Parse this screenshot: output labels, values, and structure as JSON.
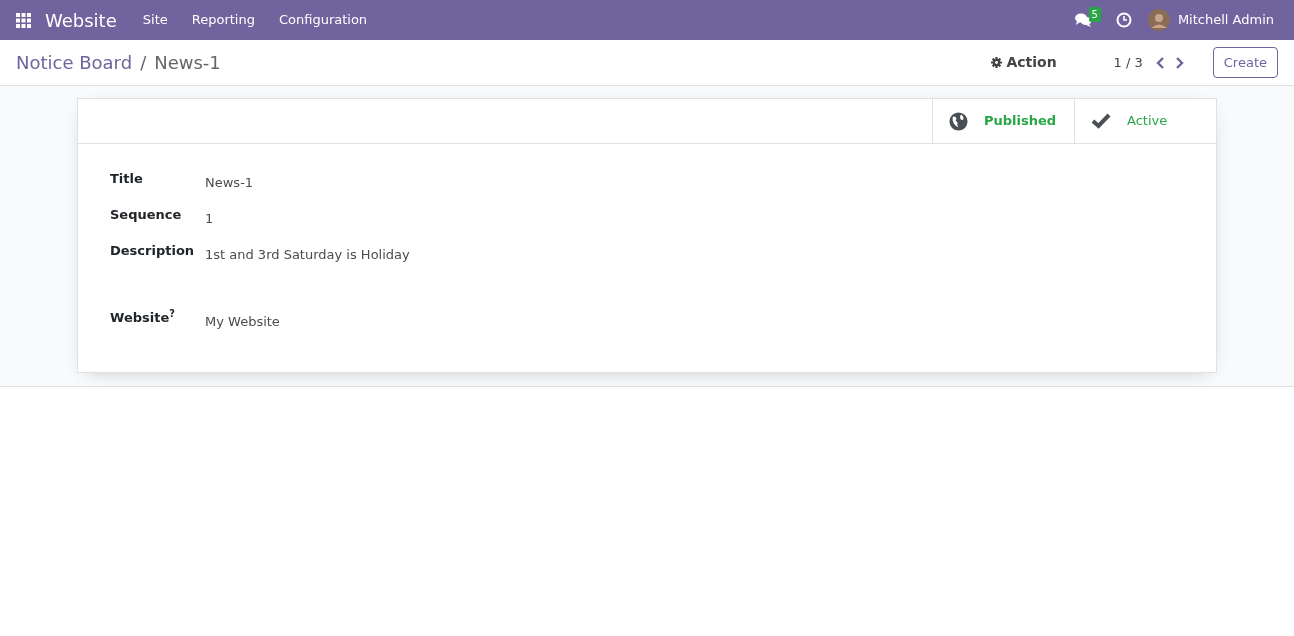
{
  "navbar": {
    "app": "Website",
    "menus": [
      "Site",
      "Reporting",
      "Configuration"
    ],
    "messages_badge": "5",
    "user": "Mitchell Admin"
  },
  "control_panel": {
    "breadcrumbs": [
      {
        "label": "Notice Board",
        "selected": false
      },
      {
        "label": "News-1",
        "selected": true
      }
    ],
    "separator": "/",
    "action": "Action",
    "pager": "1 / 3",
    "create": "Create"
  },
  "smart_buttons": [
    {
      "kind": "globe",
      "label": "Published",
      "on": true
    },
    {
      "kind": "check",
      "label": "Active",
      "on": true
    }
  ],
  "fields": [
    {
      "kind": "line",
      "label": "Title",
      "value": "News-1"
    },
    {
      "kind": "line",
      "label": "Sequence",
      "value": "1"
    },
    {
      "kind": "area",
      "label": "Description",
      "value": "1st and 3rd Saturday is Holiday"
    },
    {
      "kind": "line",
      "label": "Website$^{?}$",
      "value": "My Website"
    }
  ]
}
